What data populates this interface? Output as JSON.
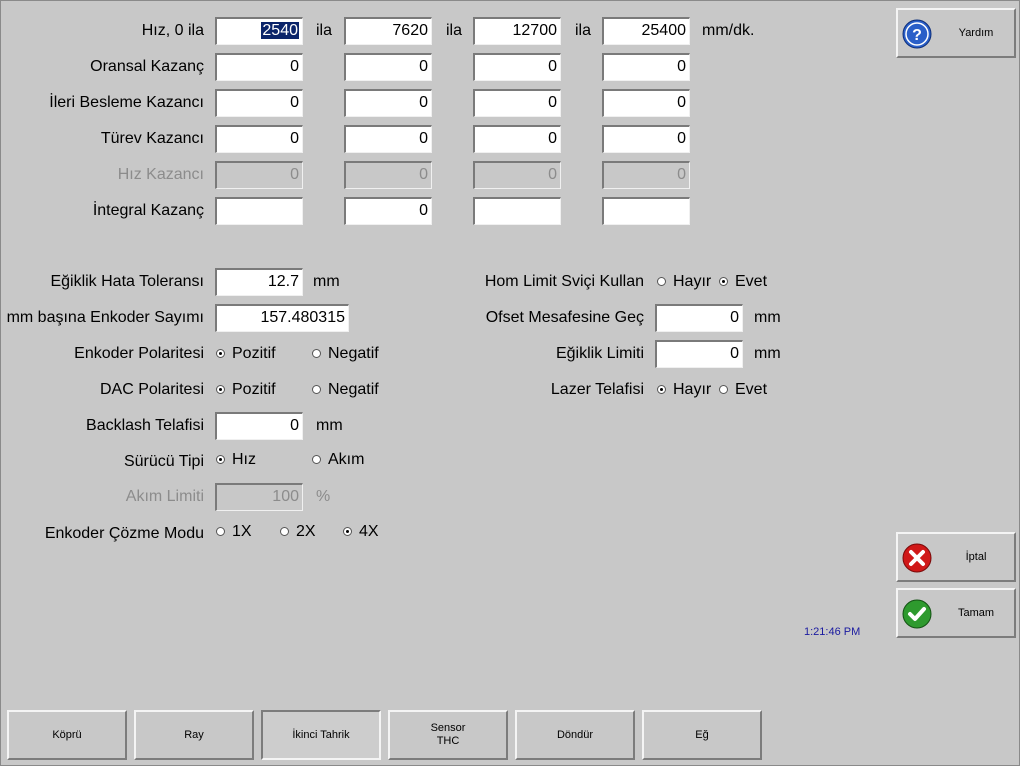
{
  "gains": {
    "speed_label": "Hız, 0 ila",
    "between_label": "ila",
    "speed_unit": "mm/dk.",
    "speeds": [
      "2540",
      "7620",
      "12700",
      "25400"
    ],
    "prop_label": "Oransal Kazanç",
    "prop_values": [
      "0",
      "0",
      "0",
      "0"
    ],
    "ff_label": "İleri Besleme Kazancı",
    "ff_values": [
      "0",
      "0",
      "0",
      "0"
    ],
    "deriv_label": "Türev Kazancı",
    "deriv_values": [
      "0",
      "0",
      "0",
      "0"
    ],
    "vel_label": "Hız Kazancı",
    "vel_values": [
      "0",
      "0",
      "0",
      "0"
    ],
    "integ_label": "İntegral Kazanç",
    "integ_values": [
      "",
      "0",
      "",
      ""
    ]
  },
  "left": {
    "skew_tol_label": "Eğiklik Hata Toleransı",
    "skew_tol_value": "12.7",
    "skew_tol_unit": "mm",
    "enc_counts_label": "mm başına Enkoder Sayımı",
    "enc_counts_value": "157.480315",
    "enc_pol_label": "Enkoder Polaritesi",
    "enc_pol_opt1": "Pozitif",
    "enc_pol_opt2": "Negatif",
    "dac_pol_label": "DAC Polaritesi",
    "dac_pol_opt1": "Pozitif",
    "dac_pol_opt2": "Negatif",
    "backlash_label": "Backlash Telafisi",
    "backlash_value": "0",
    "backlash_unit": "mm",
    "drive_label": "Sürücü Tipi",
    "drive_opt1": "Hız",
    "drive_opt2": "Akım",
    "current_label": "Akım Limiti",
    "current_value": "100",
    "current_unit": "%",
    "res_label": "Enkoder Çözme Modu",
    "res_opt1": "1X",
    "res_opt2": "2X",
    "res_opt3": "4X"
  },
  "right": {
    "home_label": "Hom Limit Sviçi Kullan",
    "home_no": "Hayır",
    "home_yes": "Evet",
    "offset_label": "Ofset Mesafesine Geç",
    "offset_value": "0",
    "offset_unit": "mm",
    "skew_limit_label": "Eğiklik Limiti",
    "skew_limit_value": "0",
    "skew_limit_unit": "mm",
    "laser_label": "Lazer Telafisi",
    "laser_no": "Hayır",
    "laser_yes": "Evet"
  },
  "side": {
    "help": "Yardım",
    "cancel": "İptal",
    "ok": "Tamam",
    "time": "1:21:46 PM"
  },
  "bottom": {
    "b1": "Köprü",
    "b2": "Ray",
    "b3": "İkinci Tahrik",
    "b4_line1": "Sensor",
    "b4_line2": "THC",
    "b5": "Döndür",
    "b6": "Eğ"
  },
  "colors": {
    "background": "#c8c8c8",
    "selection": "#0a246a",
    "help_icon": "#2a5fc8",
    "cancel_icon": "#d01818",
    "ok_icon": "#2e9a2e",
    "time_text": "#1a1aa0"
  },
  "icons": {
    "help": "question-icon",
    "cancel": "x-icon",
    "ok": "check-icon"
  }
}
